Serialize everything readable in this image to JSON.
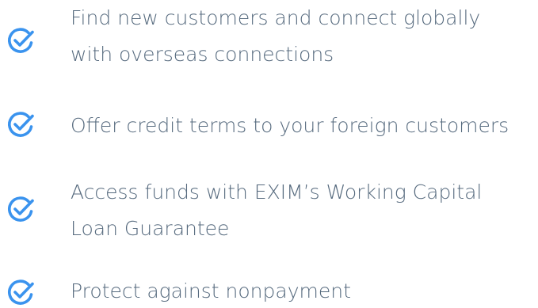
{
  "accent_color": "#3a93ee",
  "items": [
    {
      "icon": "check-circle-icon",
      "lines": [
        "Find new customers and connect globally",
        "with overseas connections"
      ]
    },
    {
      "icon": "check-circle-icon",
      "lines": [
        "Offer credit terms to your foreign customers"
      ]
    },
    {
      "icon": "check-circle-icon",
      "lines": [
        "Access funds with EXIM’s Working Capital",
        "Loan Guarantee"
      ]
    },
    {
      "icon": "check-circle-icon",
      "lines": [
        "Protect against nonpayment"
      ]
    }
  ]
}
